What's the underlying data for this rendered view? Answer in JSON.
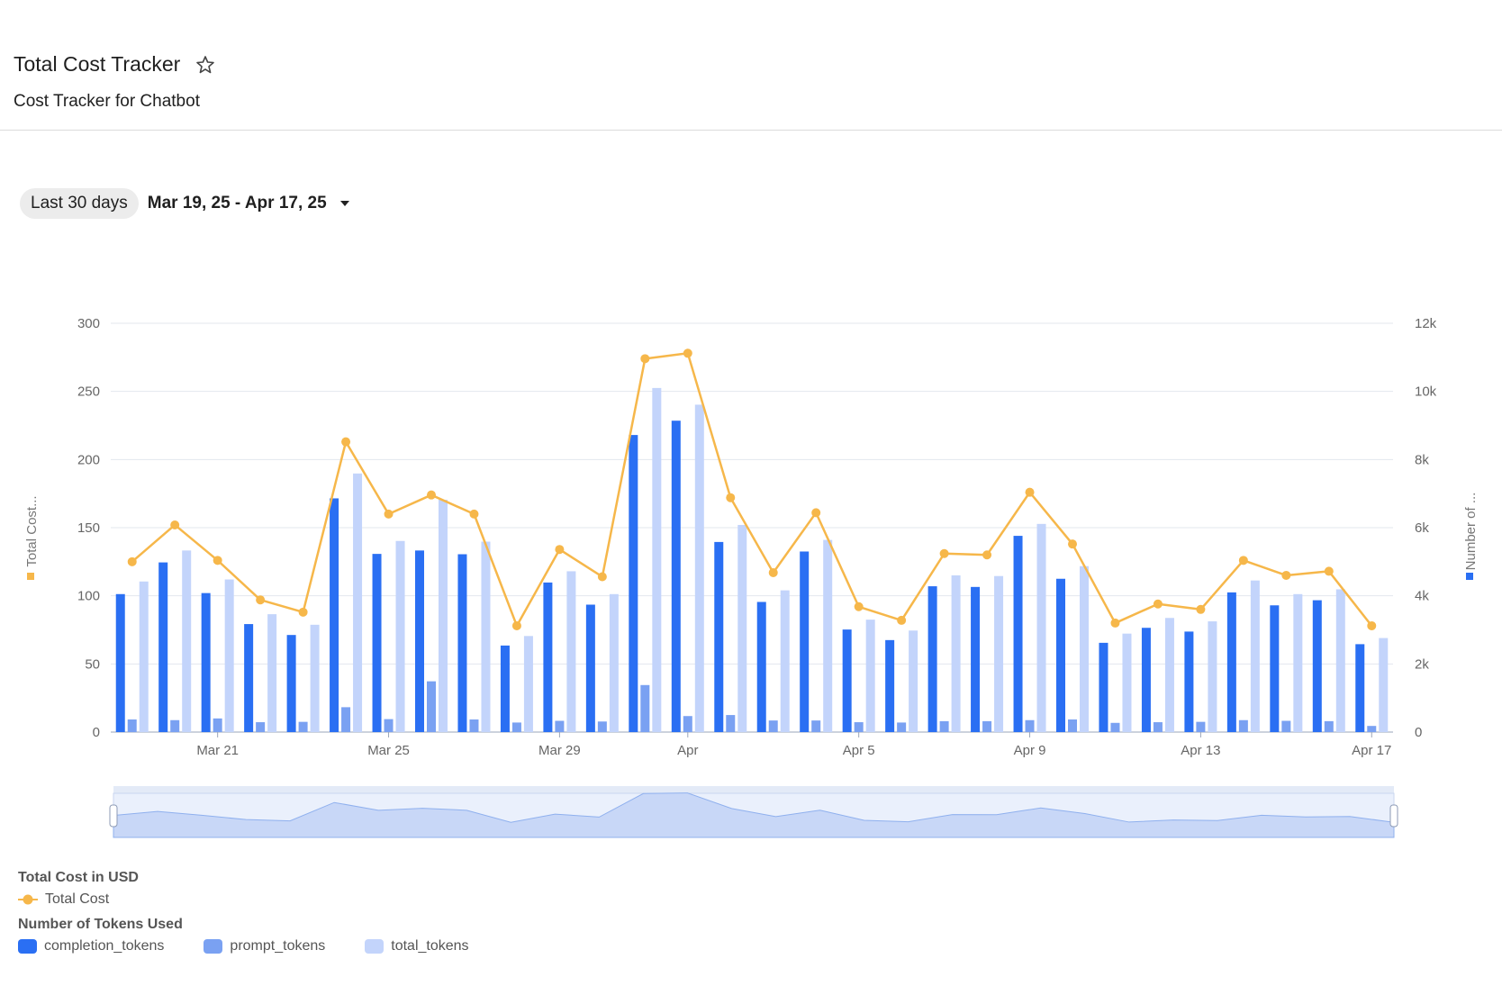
{
  "header": {
    "title": "Total Cost Tracker",
    "subtitle": "Cost Tracker for Chatbot",
    "star_icon": "star-icon"
  },
  "filter": {
    "range_label": "Last 30 days",
    "date_range": "Mar 19, 25 - Apr 17, 25",
    "dropdown_icon": "caret-down-icon"
  },
  "legend": {
    "cost_group": "Total Cost in USD",
    "cost_series": "Total Cost",
    "tokens_group": "Number of Tokens Used",
    "token_series": [
      "completion_tokens",
      "prompt_tokens",
      "total_tokens"
    ]
  },
  "colors": {
    "completion_tokens": "#2a6ff3",
    "prompt_tokens": "#7aa1f2",
    "total_tokens": "#c3d4fb",
    "total_cost": "#f6b74a"
  },
  "chart_data": {
    "type": "bar",
    "x": [
      "Mar 19",
      "Mar 20",
      "Mar 21",
      "Mar 22",
      "Mar 23",
      "Mar 24",
      "Mar 25",
      "Mar 26",
      "Mar 27",
      "Mar 28",
      "Mar 29",
      "Mar 30",
      "Mar 31",
      "Apr 1",
      "Apr 2",
      "Apr 3",
      "Apr 4",
      "Apr 5",
      "Apr 6",
      "Apr 7",
      "Apr 8",
      "Apr 9",
      "Apr 10",
      "Apr 11",
      "Apr 12",
      "Apr 13",
      "Apr 14",
      "Apr 15",
      "Apr 16",
      "Apr 17"
    ],
    "x_ticks": [
      {
        "label": "Mar 21",
        "at": "Mar 21"
      },
      {
        "label": "Mar 25",
        "at": "Mar 25"
      },
      {
        "label": "Mar 29",
        "at": "Mar 29"
      },
      {
        "label": "Apr",
        "at": "Apr 1"
      },
      {
        "label": "Apr 5",
        "at": "Apr 5"
      },
      {
        "label": "Apr 9",
        "at": "Apr 9"
      },
      {
        "label": "Apr 13",
        "at": "Apr 13"
      },
      {
        "label": "Apr 17",
        "at": "Apr 17"
      }
    ],
    "ylabel_left": "Total Cost...",
    "ylabel_right": "Number of ...",
    "ylim_left": [
      0,
      300
    ],
    "ylim_right": [
      0,
      12000
    ],
    "yticks_left": [
      "0",
      "50",
      "100",
      "150",
      "200",
      "250",
      "300"
    ],
    "yticks_right": [
      "0",
      "2k",
      "4k",
      "6k",
      "8k",
      "10k",
      "12k"
    ],
    "grid": true,
    "series": [
      {
        "name": "completion_tokens",
        "axis": "right",
        "type": "bar",
        "values": [
          4050,
          4980,
          4080,
          3170,
          2850,
          6860,
          5230,
          5330,
          5220,
          2540,
          4390,
          3740,
          8720,
          9140,
          5580,
          3820,
          5300,
          3010,
          2700,
          4280,
          4260,
          5760,
          4500,
          2620,
          3060,
          2950,
          4100,
          3720,
          3870,
          2580
        ]
      },
      {
        "name": "prompt_tokens",
        "axis": "right",
        "type": "bar",
        "values": [
          370,
          350,
          400,
          290,
          300,
          730,
          380,
          1490,
          370,
          280,
          330,
          310,
          1380,
          470,
          500,
          340,
          340,
          290,
          280,
          320,
          320,
          350,
          370,
          270,
          290,
          300,
          350,
          330,
          320,
          180
        ]
      },
      {
        "name": "total_tokens",
        "axis": "right",
        "type": "bar",
        "values": [
          4420,
          5330,
          4480,
          3460,
          3150,
          7590,
          5610,
          6820,
          5590,
          2820,
          4720,
          4050,
          10100,
          9610,
          6080,
          4160,
          5640,
          3300,
          2980,
          4600,
          4580,
          6110,
          4870,
          2890,
          3350,
          3250,
          4450,
          4050,
          4190,
          2760
        ]
      },
      {
        "name": "Total Cost",
        "axis": "left",
        "type": "line",
        "values": [
          125,
          152,
          126,
          97,
          88,
          213,
          160,
          174,
          160,
          78,
          134,
          114,
          274,
          278,
          172,
          117,
          161,
          92,
          82,
          131,
          130,
          176,
          138,
          80,
          94,
          90,
          126,
          115,
          118,
          78
        ]
      }
    ]
  }
}
